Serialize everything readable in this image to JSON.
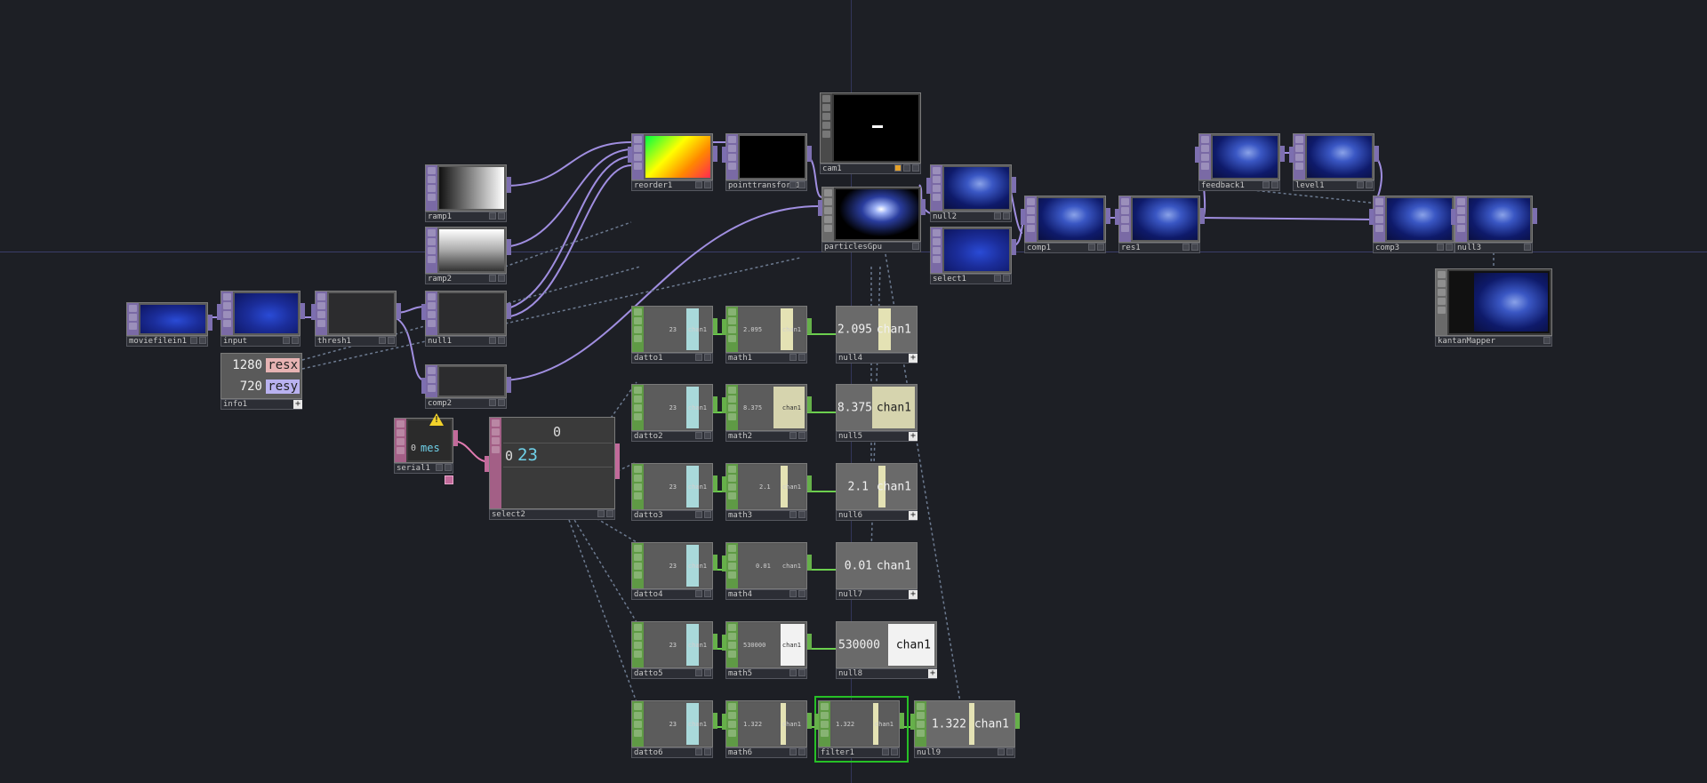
{
  "network": {
    "nodes": {
      "moviefilein1": "moviefilein1",
      "input": "input",
      "thresh1": "thresh1",
      "null1": "null1",
      "ramp1": "ramp1",
      "ramp2": "ramp2",
      "comp2": "comp2",
      "info1": "info1",
      "serial1": "serial1",
      "select2": "select2",
      "reorder1": "reorder1",
      "pointtransform1": "pointtransform1",
      "cam1": "cam1",
      "particlesGpu": "particlesGpu",
      "null2": "null2",
      "select1": "select1",
      "comp1": "comp1",
      "res1": "res1",
      "feedback1": "feedback1",
      "level1": "level1",
      "comp3": "comp3",
      "null3": "null3",
      "kantanMapper": "kantanMapper",
      "datto1": "datto1",
      "datto2": "datto2",
      "datto3": "datto3",
      "datto4": "datto4",
      "datto5": "datto5",
      "datto6": "datto6",
      "math1": "math1",
      "math2": "math2",
      "math3": "math3",
      "math4": "math4",
      "math5": "math5",
      "math6": "math6",
      "null4": "null4",
      "null5": "null5",
      "null6": "null6",
      "null7": "null7",
      "null8": "null8",
      "null9": "null9",
      "filter1": "filter1"
    },
    "info1_rows": [
      {
        "value": "1280",
        "name": "resx"
      },
      {
        "value": "720",
        "name": "resy"
      }
    ],
    "serial1_text": "0",
    "serial1_col": "mes",
    "select2_header": "0",
    "select2_index": "0",
    "select2_value": "23",
    "datto_value": "23",
    "chan_label": "chan1",
    "math": {
      "math1": "2.095",
      "math2": "8.375",
      "math3": "2.1",
      "math4": "0.01",
      "math5": "530000",
      "math6": "1.322"
    },
    "null_values": {
      "null4": "2.095",
      "null5": "8.375",
      "null6": "2.1",
      "null7": "0.01",
      "null8": "530000",
      "null9": "1.322"
    },
    "filter1_value": "1.322"
  },
  "colors": {
    "background": "#1d1f25",
    "top_wire": "#a08ee0",
    "chop_wire": "#6ccf4e",
    "dat_wire": "#e07ab0",
    "selected": "#26c026",
    "warning": "#f2d22a"
  }
}
